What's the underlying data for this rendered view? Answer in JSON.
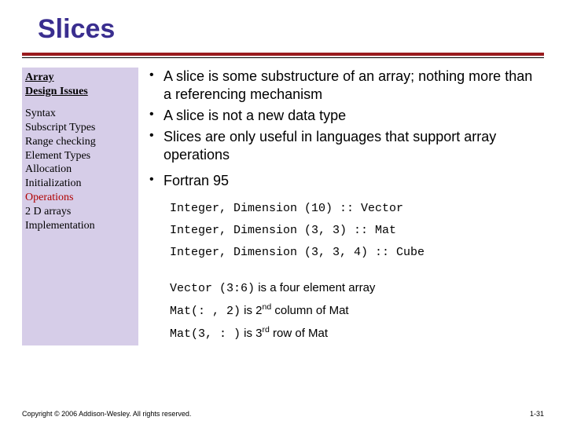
{
  "title": "Slices",
  "sidebar": {
    "heading_line1": "Array",
    "heading_line2": "Design Issues",
    "items": [
      {
        "label": "Syntax",
        "active": false
      },
      {
        "label": "Subscript Types",
        "active": false
      },
      {
        "label": "Range checking",
        "active": false
      },
      {
        "label": "Element Types",
        "active": false
      },
      {
        "label": "Allocation",
        "active": false
      },
      {
        "label": "Initialization",
        "active": false
      },
      {
        "label": "Operations",
        "active": true
      },
      {
        "label": "2 D arrays",
        "active": false
      },
      {
        "label": "Implementation",
        "active": false
      }
    ]
  },
  "bullets": [
    "A slice is some substructure of an array; nothing more than a referencing mechanism",
    "A slice is not a new data type",
    "Slices are only useful in languages that support array operations",
    "Fortran 95"
  ],
  "code_lines": [
    "Integer, Dimension (10) :: Vector",
    "Integer, Dimension (3, 3) :: Mat",
    "Integer, Dimension (3, 3, 4) :: Cube"
  ],
  "examples": [
    {
      "code": "Vector (3:6)",
      "prose_before": " is a four element array",
      "ord": "",
      "prose_after": ""
    },
    {
      "code": "Mat(: , 2)",
      "prose_before": " is 2",
      "ord": "nd",
      "prose_after": " column of Mat"
    },
    {
      "code": "Mat(3, : )",
      "prose_before": " is 3",
      "ord": "rd",
      "prose_after": " row of Mat"
    }
  ],
  "footer": {
    "copyright": "Copyright © 2006 Addison-Wesley. All rights reserved.",
    "page": "1-31"
  }
}
